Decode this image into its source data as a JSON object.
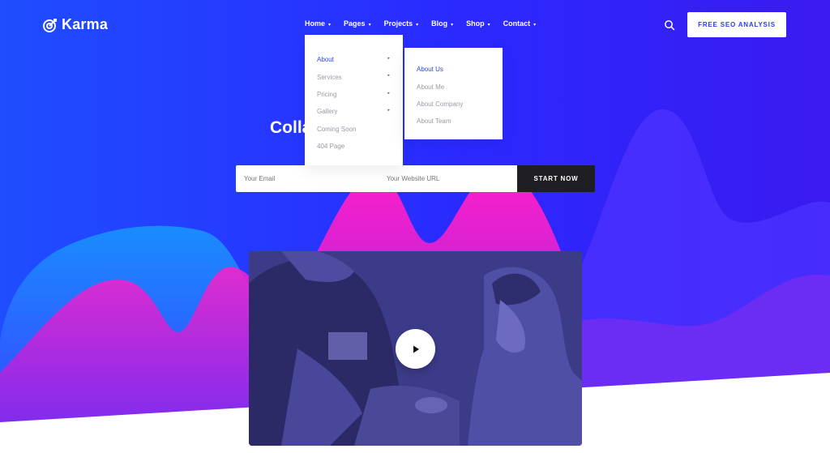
{
  "brand": {
    "name": "Karma"
  },
  "nav": [
    {
      "label": "Home",
      "caret": "▾"
    },
    {
      "label": "Pages",
      "caret": "▾"
    },
    {
      "label": "Projects",
      "caret": "▾"
    },
    {
      "label": "Blog",
      "caret": "▾"
    },
    {
      "label": "Shop",
      "caret": "▾"
    },
    {
      "label": "Contact",
      "caret": "▾"
    }
  ],
  "cta": {
    "label": "FREE SEO ANALYSIS"
  },
  "dropdown_pages": [
    {
      "label": "About",
      "has_submenu": true,
      "active": true
    },
    {
      "label": "Services",
      "has_submenu": true,
      "active": false
    },
    {
      "label": "Pricing",
      "has_submenu": true,
      "active": false
    },
    {
      "label": "Gallery",
      "has_submenu": true,
      "active": false
    },
    {
      "label": "Coming Soon",
      "has_submenu": false,
      "active": false
    },
    {
      "label": "404 Page",
      "has_submenu": false,
      "active": false
    }
  ],
  "dropdown_about": [
    {
      "label": "About Us",
      "active": true
    },
    {
      "label": "About Me",
      "active": false
    },
    {
      "label": "About Company",
      "active": false
    },
    {
      "label": "About Team",
      "active": false
    }
  ],
  "hero": {
    "headline": "Colla                                 Faster."
  },
  "form": {
    "email_placeholder": "Your Email",
    "url_placeholder": "Your Website URL",
    "submit_label": "START NOW"
  },
  "colors": {
    "primary_blue": "#2433ff",
    "magenta": "#e21ed3",
    "purple": "#7a2cf0",
    "cyan_blue": "#1a86ff",
    "dark_button": "#1e1e24",
    "video_overlay": "#3d3c8a",
    "link_active": "#2d44ff"
  },
  "icons": {
    "logo": "target-logo-icon",
    "search": "search-icon",
    "play": "play-icon"
  }
}
